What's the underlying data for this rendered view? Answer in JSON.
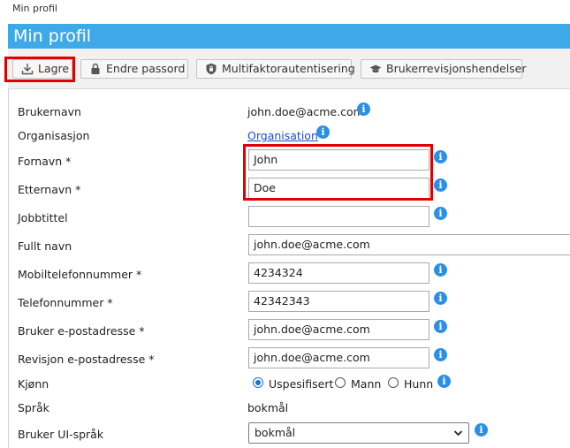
{
  "breadcrumb": "Min profil",
  "title": "Min profil",
  "toolbar": {
    "save_label": "Lagre",
    "change_password_label": "Endre passord",
    "mfa_label": "Multifaktorautentisering",
    "audit_label": "Brukerrevisjonshendelser"
  },
  "form": {
    "username": {
      "label": "Brukernavn",
      "value": "john.doe@acme.com"
    },
    "organization": {
      "label": "Organisasjon",
      "value": "Organisation"
    },
    "first_name": {
      "label": "Fornavn *",
      "value": "John"
    },
    "last_name": {
      "label": "Etternavn *",
      "value": "Doe"
    },
    "job_title": {
      "label": "Jobbtittel",
      "value": ""
    },
    "full_name": {
      "label": "Fullt navn",
      "value": "john.doe@acme.com"
    },
    "mobile": {
      "label": "Mobiltelefonnummer *",
      "value": "4234324"
    },
    "phone": {
      "label": "Telefonnummer *",
      "value": "42342343"
    },
    "user_email": {
      "label": "Bruker e-postadresse *",
      "value": "john.doe@acme.com"
    },
    "audit_email": {
      "label": "Revisjon e-postadresse *",
      "value": "john.doe@acme.com"
    },
    "gender": {
      "label": "Kjønn",
      "options": [
        "Uspesifisert",
        "Mann",
        "Hunn"
      ],
      "selected": "Uspesifisert"
    },
    "language": {
      "label": "Språk",
      "value": "bokmål"
    },
    "ui_language": {
      "label": "Bruker UI-språk",
      "value": "bokmål"
    }
  },
  "info_glyph": "i",
  "colors": {
    "header_bg": "#3ea9e8",
    "highlight": "#e00000",
    "info": "#2b8fe6",
    "link": "#1a4fc9"
  }
}
